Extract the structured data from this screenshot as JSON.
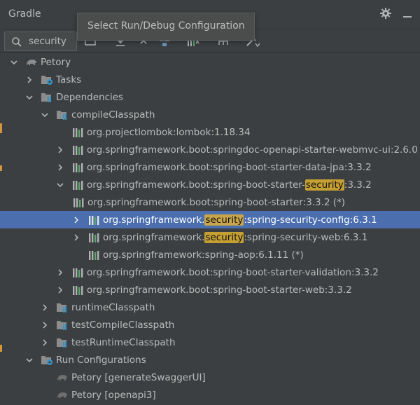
{
  "panel": {
    "title": "Gradle"
  },
  "search": {
    "value": "security"
  },
  "tooltip": {
    "text": "Select Run/Debug Configuration"
  },
  "tree": {
    "root": "Petory",
    "tasks": "Tasks",
    "dependencies": "Dependencies",
    "compile_classpath": "compileClasspath",
    "lombok": "org.projectlombok:lombok:1.18.34",
    "springdoc": "org.springframework.boot:springdoc-openapi-starter-webmvc-ui:2.6.0",
    "data_jpa": "org.springframework.boot:spring-boot-starter-data-jpa:3.3.2",
    "starter_security": {
      "pre": "org.springframework.boot:spring-boot-starter-",
      "hl": "security",
      "post": ":3.3.2"
    },
    "boot_starter": "org.springframework.boot:spring-boot-starter:3.3.2 (*)",
    "security_config": {
      "pre": "org.springframework.",
      "hl": "security",
      "post": ":spring-security-config:6.3.1"
    },
    "security_web": {
      "pre": "org.springframework.",
      "hl": "security",
      "post": ":spring-security-web:6.3.1"
    },
    "spring_aop": "org.springframework:spring-aop:6.1.11 (*)",
    "validation": "org.springframework.boot:spring-boot-starter-validation:3.3.2",
    "web": "org.springframework.boot:spring-boot-starter-web:3.3.2",
    "runtime_classpath": "runtimeClasspath",
    "test_compile_classpath": "testCompileClasspath",
    "test_runtime_classpath": "testRuntimeClasspath",
    "run_configurations": "Run Configurations",
    "run_swagger": "Petory [generateSwaggerUI]",
    "run_openapi": "Petory [openapi3]"
  },
  "colors": {
    "selection": "#4b6eaf",
    "highlight": "#c59f32",
    "background": "#3c3f41"
  }
}
